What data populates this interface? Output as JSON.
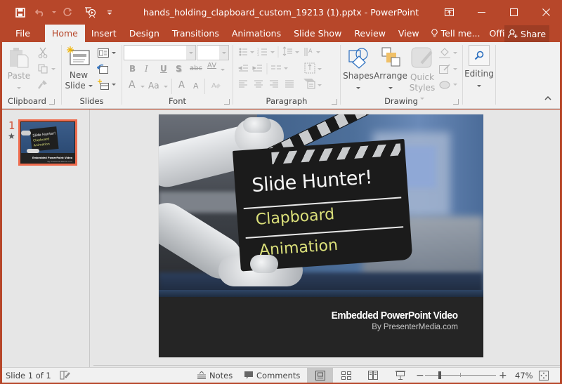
{
  "app": {
    "title": "hands_holding_clapboard_custom_19213 (1).pptx - PowerPoint",
    "accent_color": "#b7472a"
  },
  "qat": {
    "save": "save-icon",
    "undo": "undo-icon",
    "redo": "redo-icon",
    "present": "start-from-beginning-icon",
    "customize": "customize-qat-icon"
  },
  "window_controls": [
    "ribbon-display-options",
    "minimize",
    "maximize",
    "close"
  ],
  "tabs": [
    {
      "label": "File"
    },
    {
      "label": "Home",
      "active": true
    },
    {
      "label": "Insert"
    },
    {
      "label": "Design"
    },
    {
      "label": "Transitions"
    },
    {
      "label": "Animations"
    },
    {
      "label": "Slide Show"
    },
    {
      "label": "Review"
    },
    {
      "label": "View"
    },
    {
      "label": "Tell me..."
    },
    {
      "label": "Office Tut..."
    }
  ],
  "share": {
    "label": "Share"
  },
  "ribbon": {
    "clipboard": {
      "label": "Clipboard",
      "paste": "Paste"
    },
    "slides": {
      "label": "Slides",
      "new_slide_line1": "New",
      "new_slide_line2": "Slide"
    },
    "font": {
      "label": "Font",
      "font_name_value": "",
      "font_size_value": "",
      "bold": "B",
      "italic": "I",
      "underline": "U",
      "shadow": "S",
      "strike": "abc",
      "spacing": "AV",
      "font_color": "A",
      "change_case": "Aa",
      "grow": "A",
      "shrink": "A"
    },
    "paragraph": {
      "label": "Paragraph"
    },
    "drawing": {
      "label": "Drawing",
      "shapes": "Shapes",
      "arrange": "Arrange",
      "quick_styles_line1": "Quick",
      "quick_styles_line2": "Styles"
    },
    "editing": {
      "label": "Editing"
    }
  },
  "thumbnails": [
    {
      "number": "1",
      "has_animation": true,
      "selected": true
    }
  ],
  "slide": {
    "clapboard_line1": "Slide Hunter!",
    "clapboard_line2": "Clapboard",
    "clapboard_line3": "Animation",
    "title": "Embedded PowerPoint Video",
    "subtitle": "By PresenterMedia.com",
    "thumb_title": "Embedded PowerPoint Video",
    "thumb_sub": "By PresenterMedia.com"
  },
  "status": {
    "slide_info": "Slide 1 of 1",
    "notes": "Notes",
    "comments": "Comments",
    "zoom_level": "47%",
    "zoom_fraction": 0.47
  }
}
